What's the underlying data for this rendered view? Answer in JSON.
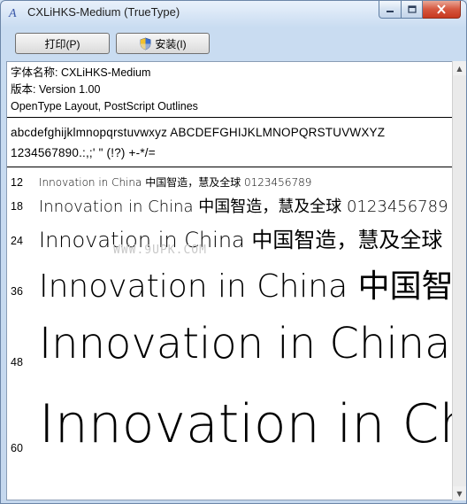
{
  "window": {
    "title": "CXLiHKS-Medium (TrueType)"
  },
  "toolbar": {
    "print_label": "打印(P)",
    "install_label": "安装(I)"
  },
  "font_info": {
    "name_line": "字体名称: CXLiHKS-Medium",
    "version_line": "版本: Version 1.00",
    "type_line": "OpenType Layout, PostScript Outlines"
  },
  "charset": {
    "line1": "abcdefghijklmnopqrstuvwxyz ABCDEFGHIJKLMNOPQRSTUVWXYZ",
    "line2": "1234567890.:,;' \" (!?) +-*/="
  },
  "samples": [
    {
      "size": "12",
      "text": "Innovation in China 中国智造，慧及全球 0123456789"
    },
    {
      "size": "18",
      "text": "Innovation in China 中国智造，慧及全球 0123456789"
    },
    {
      "size": "24",
      "text": "Innovation in China 中国智造，慧及全球"
    },
    {
      "size": "36",
      "text": "Innovation in China 中国智造"
    },
    {
      "size": "48",
      "text": "Innovation in China"
    },
    {
      "size": "60",
      "text": "Innovation in China"
    }
  ],
  "watermark": "WWW.9UPK.COM",
  "colors": {
    "title_bar": "#c9dcf1",
    "close_button": "#c7391f"
  }
}
